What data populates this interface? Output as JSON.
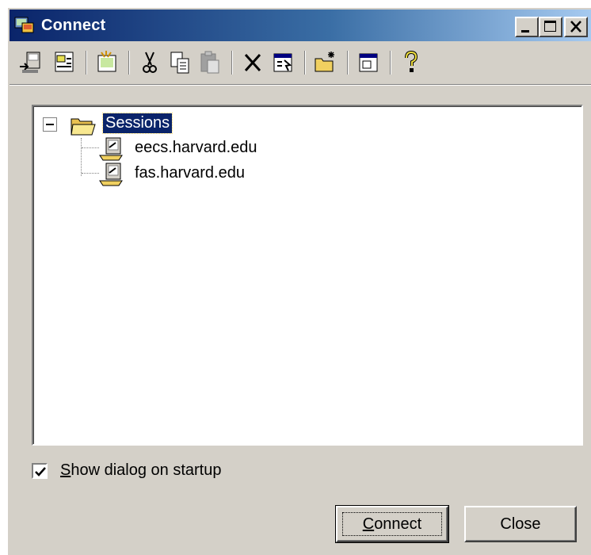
{
  "window": {
    "title": "Connect",
    "controls": [
      "minimize",
      "maximize",
      "close"
    ]
  },
  "toolbar": {
    "buttons": [
      {
        "name": "quick-connect-icon"
      },
      {
        "name": "connect-tab-icon"
      },
      {
        "name": "new-session-icon"
      },
      {
        "name": "cut-icon"
      },
      {
        "name": "copy-icon"
      },
      {
        "name": "paste-icon"
      },
      {
        "name": "delete-icon"
      },
      {
        "name": "properties-icon"
      },
      {
        "name": "new-folder-icon"
      },
      {
        "name": "window-icon"
      },
      {
        "name": "help-icon"
      }
    ]
  },
  "tree": {
    "root": "Sessions",
    "sessions": [
      "eecs.harvard.edu",
      "fas.harvard.edu"
    ]
  },
  "options": {
    "show_dialog_first": "S",
    "show_dialog_rest": "how dialog on startup",
    "show_dialog_checked": true
  },
  "buttons": {
    "connect_first": "C",
    "connect_rest": "onnect",
    "close": "Close"
  },
  "colors": {
    "face": "#d4d0c8",
    "title_start": "#0a246a",
    "title_end": "#a6caf0",
    "selection": "#0a246a"
  }
}
